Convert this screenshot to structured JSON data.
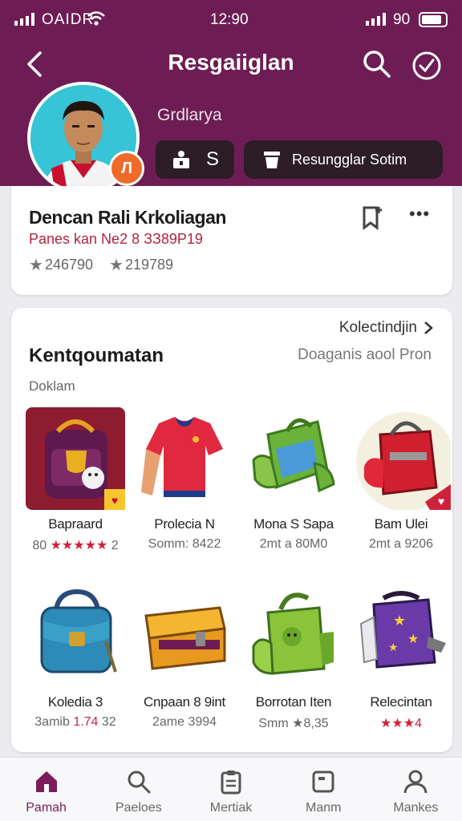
{
  "status_bar": {
    "carrier": "OAIDR",
    "time": "12:90",
    "battery_text": "90"
  },
  "header": {
    "title": "Resgaiiglan",
    "subtitle": "Grdlarya",
    "pill_text": "S",
    "action_button": "Resungglar Sotim"
  },
  "profile_card": {
    "title": "Dencan Rali Krkoliagan",
    "subtitle": "Panes kan Ne2 8 ЗЗ89Р19",
    "stat_1": "246790",
    "stat_2": "219789"
  },
  "collection": {
    "view_all": "Kolectindjin",
    "title": "Kentqoumatan",
    "right_label": "Doaganis aool Pron",
    "label": "Doklam",
    "items": [
      {
        "name": "Bapraard",
        "meta_pre": "80",
        "stars": "★★★★★",
        "meta_post": "2",
        "image": "maroon-backpack-mascot-icon"
      },
      {
        "name": "Prolecia N",
        "meta_pre": "Somm: 8422",
        "stars": "",
        "meta_post": "",
        "image": "red-jersey-icon"
      },
      {
        "name": "Mona S Sapa",
        "meta_pre": "2mt a 80M0",
        "stars": "",
        "meta_post": "",
        "image": "green-backpack-icon"
      },
      {
        "name": "Bam Ulei",
        "meta_pre": "2mt a 9206",
        "stars": "",
        "meta_post": "",
        "image": "red-backpack-icon"
      },
      {
        "name": "Koledia 3",
        "meta_pre": "3amib",
        "stars": "1.74",
        "meta_post": "32",
        "image": "teal-bag-icon"
      },
      {
        "name": "Cnpaan 8 9int",
        "meta_pre": "2ame 3994",
        "stars": "",
        "meta_post": "",
        "image": "yellow-case-icon"
      },
      {
        "name": "Borrotan Iten",
        "meta_pre": "Smm ★8,35",
        "stars": "",
        "meta_post": "",
        "image": "green-bag-icon"
      },
      {
        "name": "Relecintan",
        "meta_pre": "",
        "stars": "★★★",
        "meta_post": "4",
        "image": "purple-jacket-icon"
      }
    ]
  },
  "nav": {
    "tabs": [
      {
        "label": "Pamah",
        "icon": "home-icon"
      },
      {
        "label": "Paeloes",
        "icon": "search-icon"
      },
      {
        "label": "Mertiak",
        "icon": "clipboard-icon"
      },
      {
        "label": "Manm",
        "icon": "square-icon"
      },
      {
        "label": "Mankes",
        "icon": "person-icon"
      }
    ],
    "active_color": "#7a1c5a"
  },
  "colors": {
    "header": "#6e1d54",
    "accent_red": "#d0213a",
    "badge": "#f06a2a"
  }
}
